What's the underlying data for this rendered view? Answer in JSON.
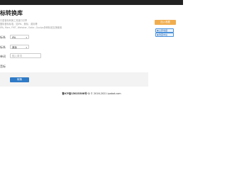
{
  "header": {
    "title": "标转换库"
  },
  "description": [
    "口语音标转换工具接口引擎",
    "国际音标标准，如IPA、美标、英标等",
    "IPA, Merr, FMT, Wehster, Oxfor, Guxlps多种标准互换使用"
  ],
  "form": {
    "from_label": "标系",
    "from_value": "IPA",
    "to_label": "标系",
    "to_value": "美标",
    "word_label": "单词",
    "word_placeholder": "输入单词",
    "result_label": "音标"
  },
  "actions": {
    "convert_label": "转换"
  },
  "sidebar": {
    "orange_button": "加入收藏",
    "button_1": "立即收藏",
    "button_2": "收藏本站"
  },
  "footer": {
    "icp": "鲁ICP备15023308号-1",
    "copyright": "© 2016-2021 ipabot.com"
  }
}
